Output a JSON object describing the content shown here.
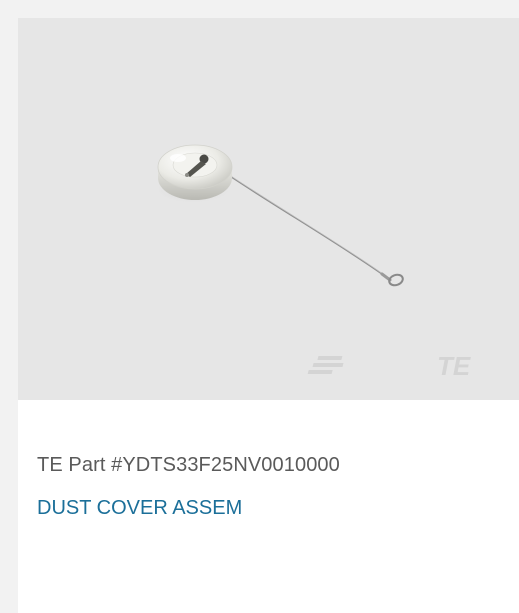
{
  "product": {
    "image": {
      "logo_text": "TE",
      "background_color": "#e6e6e6"
    },
    "part_number": "TE Part #YDTS33F25NV0010000",
    "name": "DUST COVER ASSEM",
    "colors": {
      "part_number_text": "#5a5a5a",
      "name_link": "#1b6f99",
      "card_background": "#ffffff",
      "page_background": "#f2f2f2"
    }
  }
}
